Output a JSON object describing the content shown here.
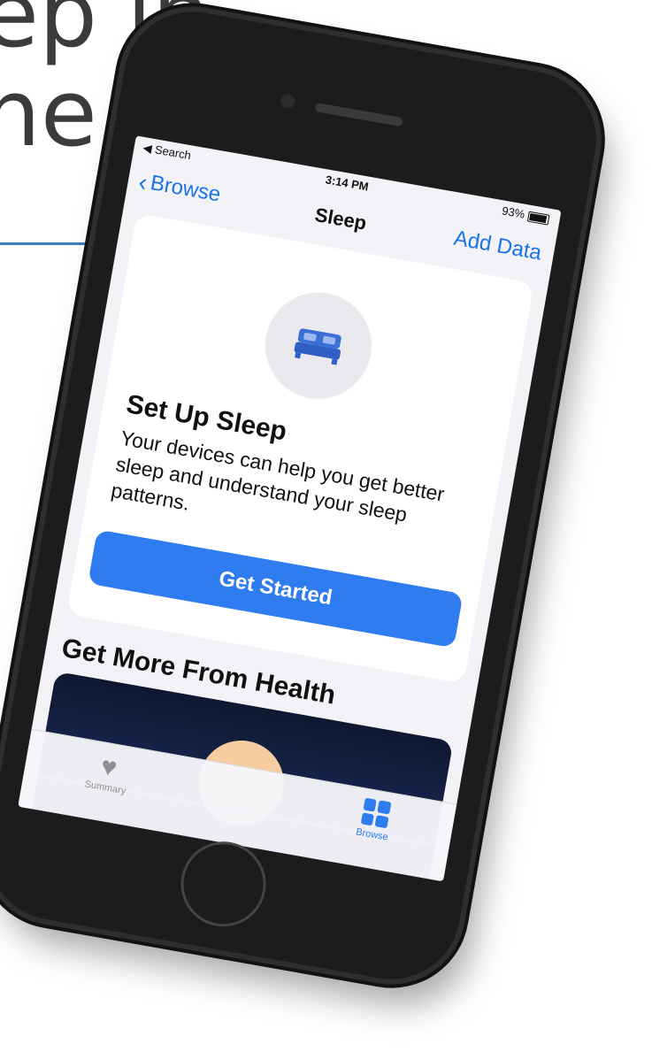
{
  "slide": {
    "title_line1": "ep in",
    "title_line2": "ne"
  },
  "status_bar": {
    "back_app": "◀ Search",
    "time": "3:14 PM",
    "battery": "93%"
  },
  "nav": {
    "back_label": "Browse",
    "title": "Sleep",
    "action_label": "Add Data"
  },
  "setup_card": {
    "title": "Set Up Sleep",
    "body": "Your devices can help you get better sleep and understand your sleep patterns.",
    "button_label": "Get Started"
  },
  "section": {
    "title": "Get More From Health"
  },
  "tab_bar": {
    "items": [
      {
        "label": "Summary",
        "icon": "heart-icon"
      },
      {
        "label": "Browse",
        "icon": "grid-icon",
        "selected": true
      }
    ]
  },
  "colors": {
    "accent": "#2e7cf0",
    "slide_rule": "#3f7cbf"
  }
}
